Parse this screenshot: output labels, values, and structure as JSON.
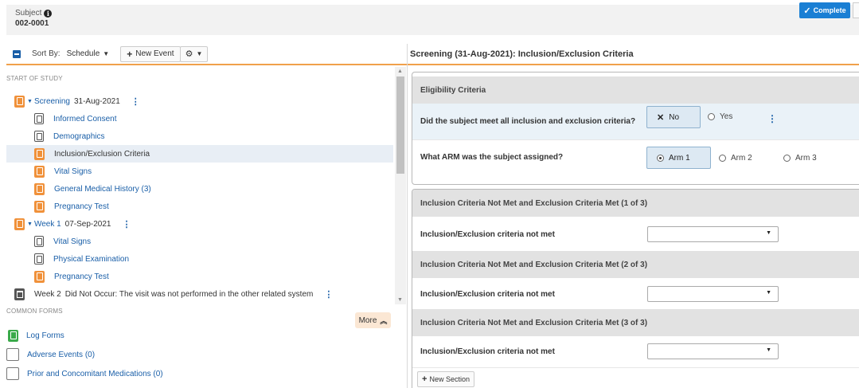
{
  "subject": {
    "label": "Subject",
    "id": "002-0001"
  },
  "toolbar": {
    "sort_label": "Sort By:",
    "sort_value": "Schedule",
    "new_event": "New Event"
  },
  "tree": {
    "start_label": "START OF STUDY",
    "events": [
      {
        "name": "Screening",
        "date": "31-Aug-2021"
      },
      {
        "name": "Week 1",
        "date": "07-Sep-2021"
      }
    ],
    "screening_forms": [
      "Informed Consent",
      "Demographics",
      "Inclusion/Exclusion Criteria",
      "Vital Signs",
      "General Medical History (3)",
      "Pregnancy Test"
    ],
    "week1_forms": [
      "Vital Signs",
      "Physical Examination",
      "Pregnancy Test"
    ],
    "week2": {
      "name": "Week 2",
      "text": "Did Not Occur: The visit was not performed in the other related system"
    }
  },
  "common_forms": {
    "label": "COMMON FORMS",
    "more": "More",
    "items": [
      "Log Forms",
      "Adverse Events (0)",
      "Prior and Concomitant Medications (0)"
    ]
  },
  "right": {
    "title": "Screening (31-Aug-2021): Inclusion/Exclusion Criteria",
    "complete": "Complete",
    "eligibility": {
      "header": "Eligibility Criteria",
      "q1": {
        "label": "Did the subject meet all inclusion and exclusion criteria?",
        "options": [
          "No",
          "Yes"
        ],
        "selected": "No"
      },
      "q2": {
        "label": "What ARM was the subject assigned?",
        "options": [
          "Arm 1",
          "Arm 2",
          "Arm 3"
        ],
        "selected": "Arm 1"
      }
    },
    "sections": [
      {
        "header": "Inclusion Criteria Not Met and Exclusion Criteria Met (1 of 3)",
        "field": "Inclusion/Exclusion criteria not met",
        "value": ""
      },
      {
        "header": "Inclusion Criteria Not Met and Exclusion Criteria Met (2 of 3)",
        "field": "Inclusion/Exclusion criteria not met",
        "value": ""
      },
      {
        "header": "Inclusion Criteria Not Met and Exclusion Criteria Met (3 of 3)",
        "field": "Inclusion/Exclusion criteria not met",
        "value": ""
      }
    ],
    "new_section": "New Section"
  },
  "colors": {
    "accent_orange": "#f0913a",
    "link_blue": "#1a5fa8",
    "complete_blue": "#1a7fd4",
    "log_green": "#3aaa4a"
  }
}
